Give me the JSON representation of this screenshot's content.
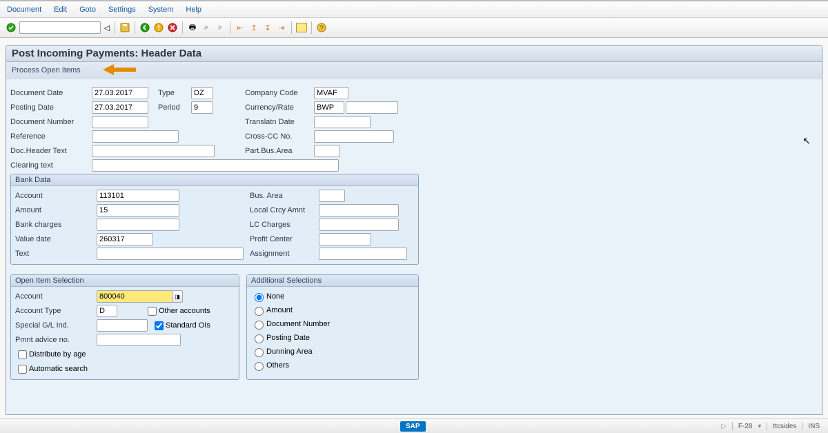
{
  "menubar": [
    "Document",
    "Edit",
    "Goto",
    "Settings",
    "System",
    "Help"
  ],
  "page_title": "Post Incoming Payments: Header Data",
  "sub_link": "Process Open Items",
  "header": {
    "doc_date_lbl": "Document Date",
    "doc_date": "27.03.2017",
    "type_lbl": "Type",
    "type": "DZ",
    "company_lbl": "Company Code",
    "company": "MVAF",
    "post_date_lbl": "Posting Date",
    "post_date": "27.03.2017",
    "period_lbl": "Period",
    "period": "9",
    "currency_lbl": "Currency/Rate",
    "currency": "BWP",
    "rate": "",
    "docnum_lbl": "Document Number",
    "docnum": "",
    "transl_lbl": "Translatn Date",
    "transl": "",
    "ref_lbl": "Reference",
    "ref": "",
    "cross_lbl": "Cross-CC No.",
    "cross": "",
    "doctext_lbl": "Doc.Header Text",
    "doctext": "",
    "pba_lbl": "Part.Bus.Area",
    "pba": "",
    "clear_lbl": "Clearing text",
    "clear": ""
  },
  "bank": {
    "title": "Bank Data",
    "account_lbl": "Account",
    "account": "113101",
    "busarea_lbl": "Bus. Area",
    "busarea": "",
    "amount_lbl": "Amount",
    "amount": "15",
    "local_lbl": "Local Crcy Amnt",
    "local": "",
    "charges_lbl": "Bank charges",
    "charges": "",
    "lc_lbl": "LC Charges",
    "lc": "",
    "value_lbl": "Value date",
    "value": "260317",
    "pc_lbl": "Profit Center",
    "pc": "",
    "text_lbl": "Text",
    "text": "",
    "assign_lbl": "Assignment",
    "assign": ""
  },
  "open": {
    "title": "Open Item Selection",
    "account_lbl": "Account",
    "account": "800040",
    "acct_type_lbl": "Account Type",
    "acct_type": "D",
    "other_lbl": "Other accounts",
    "other": false,
    "sgl_lbl": "Special G/L Ind.",
    "sgl": "",
    "std_lbl": "Standard OIs",
    "std": true,
    "pmnt_lbl": "Pmnt advice no.",
    "pmnt": "",
    "dist_lbl": "Distribute by age",
    "dist": false,
    "auto_lbl": "Automatic search",
    "auto": false
  },
  "add": {
    "title": "Additional Selections",
    "none": "None",
    "amount": "Amount",
    "docnum": "Document Number",
    "post": "Posting Date",
    "dunn": "Dunning Area",
    "others": "Others",
    "selected": "none"
  },
  "footer": {
    "tcode": "F-28",
    "user": "ttcsides",
    "mode": "INS"
  }
}
